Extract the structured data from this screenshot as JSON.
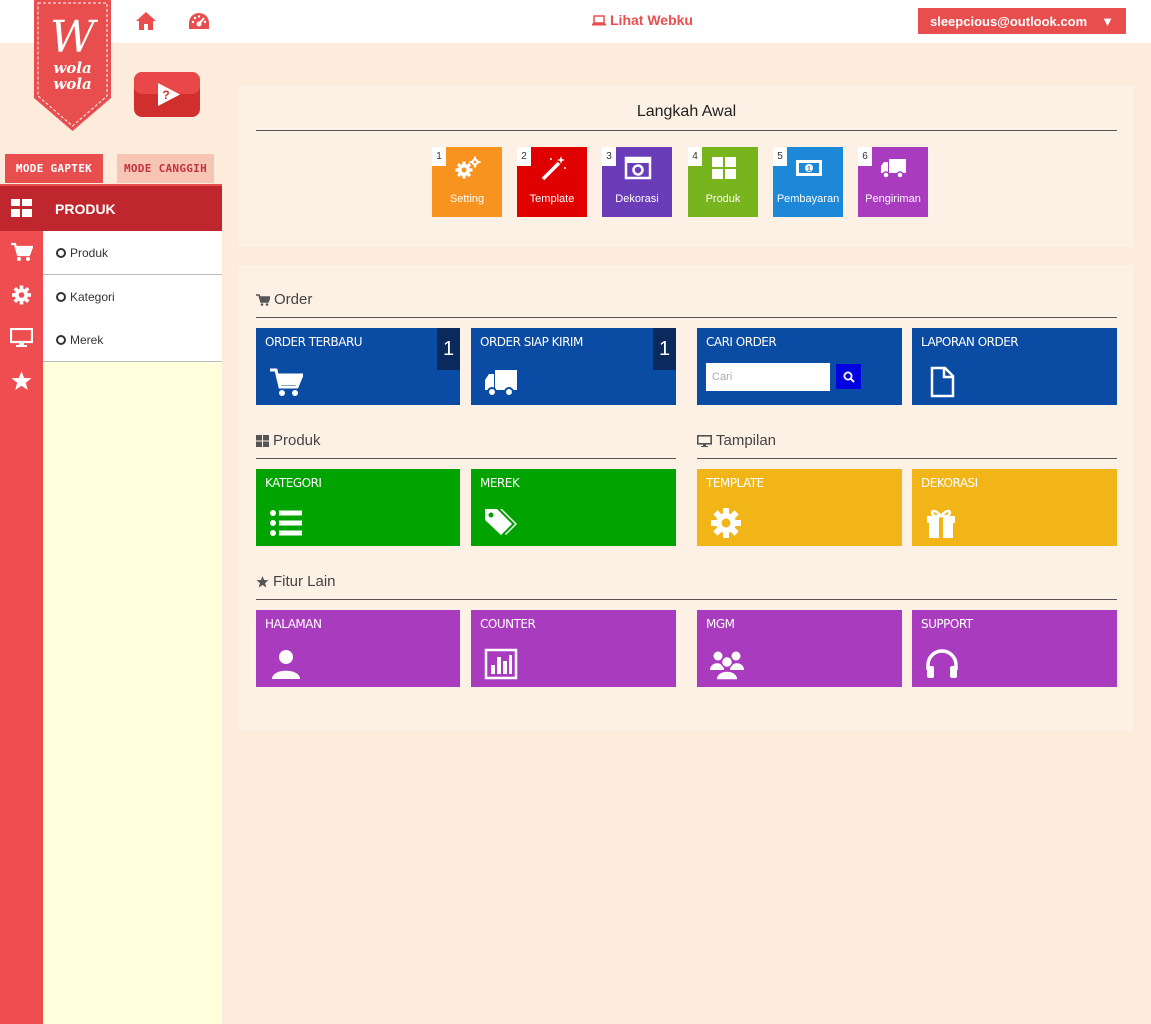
{
  "header": {
    "logo_text": "wola wola",
    "lihat_label": "Lihat Webku",
    "account_email": "sleepcious@outlook.com",
    "account_caret": "▼"
  },
  "modes": {
    "gaptek": "MODE GAPTEK",
    "canggih": "MODE CANGGIH"
  },
  "sidebar": {
    "active_menu": "PRODUK",
    "items": [
      "Produk",
      "Kategori",
      "Merek"
    ]
  },
  "langkah": {
    "title": "Langkah Awal",
    "steps": [
      {
        "num": "1",
        "label": "Setting",
        "color": "#f7931e",
        "icon": "gears-icon"
      },
      {
        "num": "2",
        "label": "Template",
        "color": "#e00000",
        "icon": "magic-wand-icon"
      },
      {
        "num": "3",
        "label": "Dekorasi",
        "color": "#6a3cb8",
        "icon": "camera-icon"
      },
      {
        "num": "4",
        "label": "Produk",
        "color": "#78b41e",
        "icon": "grid-icon"
      },
      {
        "num": "5",
        "label": "Pembayaran",
        "color": "#1d87d8",
        "icon": "money-icon"
      },
      {
        "num": "6",
        "label": "Pengiriman",
        "color": "#a93bbf",
        "icon": "truck-icon"
      }
    ]
  },
  "order": {
    "title": "Order",
    "terbaru": {
      "label": "ORDER TERBARU",
      "count": "1"
    },
    "siap_kirim": {
      "label": "ORDER SIAP KIRIM",
      "count": "1"
    },
    "cari": {
      "label": "CARI ORDER",
      "placeholder": "Cari"
    },
    "laporan": {
      "label": "LAPORAN ORDER"
    }
  },
  "produk_section": {
    "title": "Produk",
    "kategori": "KATEGORI",
    "merek": "MEREK"
  },
  "tampilan": {
    "title": "Tampilan",
    "template": "TEMPLATE",
    "dekorasi": "DEKORASI"
  },
  "fitur": {
    "title": "Fitur Lain",
    "halaman": "HALAMAN",
    "counter": "COUNTER",
    "mgm": "MGM",
    "support": "SUPPORT"
  },
  "colors": {
    "accent": "#e94e4e",
    "sidebar_strip": "#ef4e50",
    "active_menu": "#c0262d",
    "blue_tile": "#0a4ba4",
    "green_tile": "#00a300",
    "yellow_tile": "#f1b517",
    "purple_tile": "#a93bbf"
  }
}
